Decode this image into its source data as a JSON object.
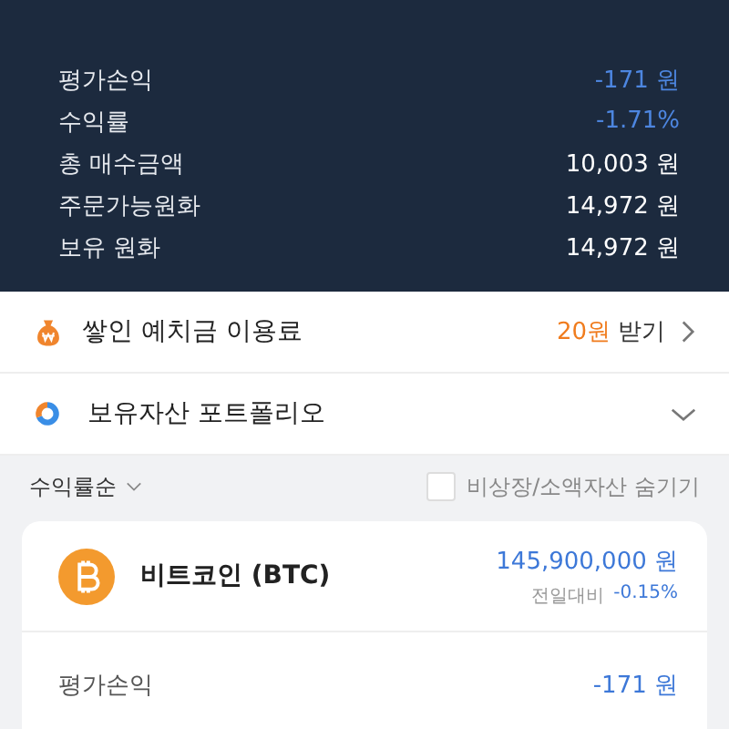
{
  "summary": {
    "rows": [
      {
        "label": "평가손익",
        "value": "-171 원",
        "color": "#4d86e0"
      },
      {
        "label": "수익률",
        "value": "-1.71%",
        "color": "#4d86e0"
      },
      {
        "label": "총 매수금액",
        "value": "10,003 원",
        "color": "#ffffff"
      },
      {
        "label": "주문가능원화",
        "value": "14,972 원",
        "color": "#ffffff"
      },
      {
        "label": "보유 원화",
        "value": "14,972 원",
        "color": "#ffffff"
      }
    ]
  },
  "deposit_fee": {
    "title": "쌓인 예치금 이용료",
    "amount": "20원",
    "action": "받기"
  },
  "portfolio": {
    "title": "보유자산 포트폴리오",
    "expanded": false
  },
  "list_controls": {
    "sort": "수익률순",
    "hide_small": {
      "label": "비상장/소액자산 숨기기",
      "checked": false
    }
  },
  "assets": [
    {
      "name": "비트코인 (BTC)",
      "price": "145,900,000 원",
      "change_label": "전일대비",
      "change": "-0.15%",
      "color": "#3d78d8",
      "rows": [
        {
          "label": "평가손익",
          "value": "-171 원",
          "color": "#3d78d8"
        }
      ]
    }
  ]
}
